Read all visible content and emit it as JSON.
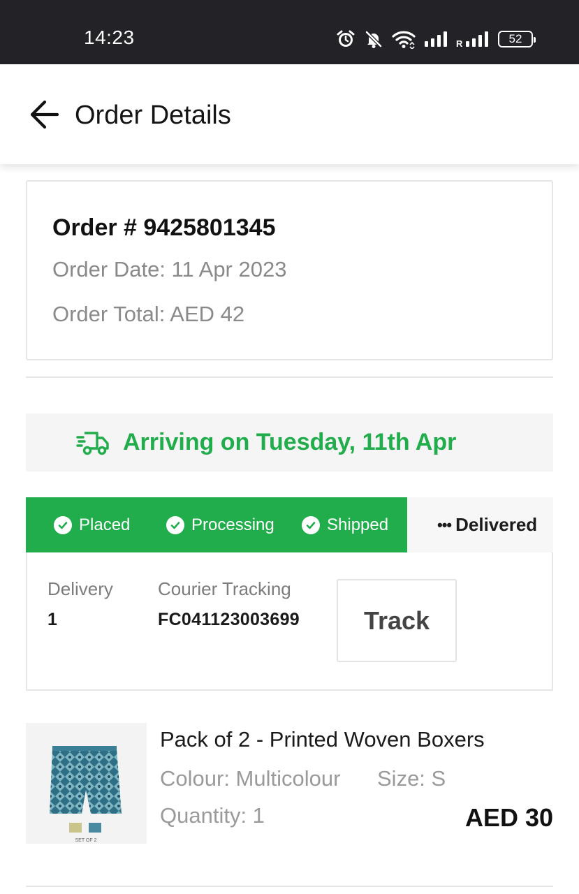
{
  "status_bar": {
    "time": "14:23",
    "battery": "52",
    "network_label": "R",
    "icons": [
      "alarm-icon",
      "bell-off-icon",
      "wifi-icon",
      "signal-icon",
      "signal-roaming-icon",
      "battery-icon"
    ]
  },
  "header": {
    "title": "Order Details",
    "back_icon": "arrow-left-icon"
  },
  "order": {
    "number": "Order # 9425801345",
    "date": "Order Date: 11 Apr 2023",
    "total": "Order Total: AED 42"
  },
  "shipment": {
    "arriving": "Arriving on Tuesday, 11th Apr",
    "steps": [
      {
        "label": "Placed",
        "done": true
      },
      {
        "label": "Processing",
        "done": true
      },
      {
        "label": "Shipped",
        "done": true
      },
      {
        "label": "Delivered",
        "done": false
      }
    ],
    "delivery_label": "Delivery",
    "delivery_value": "1",
    "courier_label": "Courier Tracking",
    "courier_value": "FC041123003699",
    "track_button": "Track"
  },
  "product": {
    "name": "Pack of 2 - Printed Woven Boxers",
    "colour": "Colour: Multicolour",
    "size": "Size: S",
    "quantity": "Quantity: 1",
    "price": "AED 30",
    "image_caption": "SET OF 2"
  },
  "colors": {
    "accent_green": "#21ad4b",
    "status_bar_bg": "#232327",
    "muted_text": "#8a8a8a"
  }
}
